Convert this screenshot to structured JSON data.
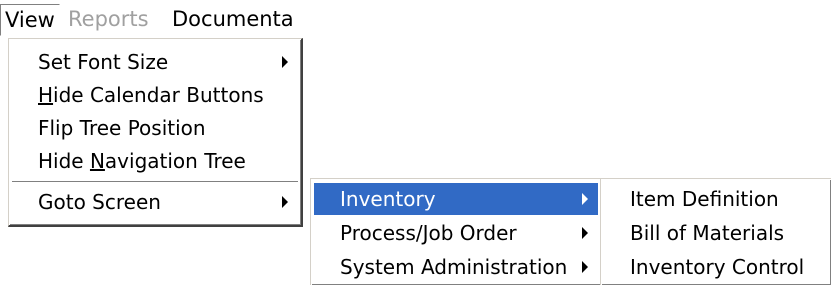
{
  "menubar": {
    "view": "View",
    "reports": "Reports",
    "documentation": "Documenta"
  },
  "view_menu": {
    "set_font_size": "Set Font Size",
    "hide_calendar_first": "H",
    "hide_calendar_rest": "ide Calendar Buttons",
    "flip_tree_position": "Flip Tree Position",
    "hide_nav_before": "Hide ",
    "hide_nav_mnemonic": "N",
    "hide_nav_after": "avigation Tree",
    "goto_screen": "Goto Screen"
  },
  "goto_menu": {
    "items": [
      "Inventory",
      "Process/Job Order",
      "System Administration"
    ]
  },
  "inventory_menu": {
    "items": [
      "Item Definition",
      "Bill of Materials",
      "Inventory Control"
    ]
  },
  "colors": {
    "highlight": "#316ac5",
    "disabled_text": "#a0a0a0"
  },
  "icons": {
    "submenu": "chevron-right-icon"
  }
}
